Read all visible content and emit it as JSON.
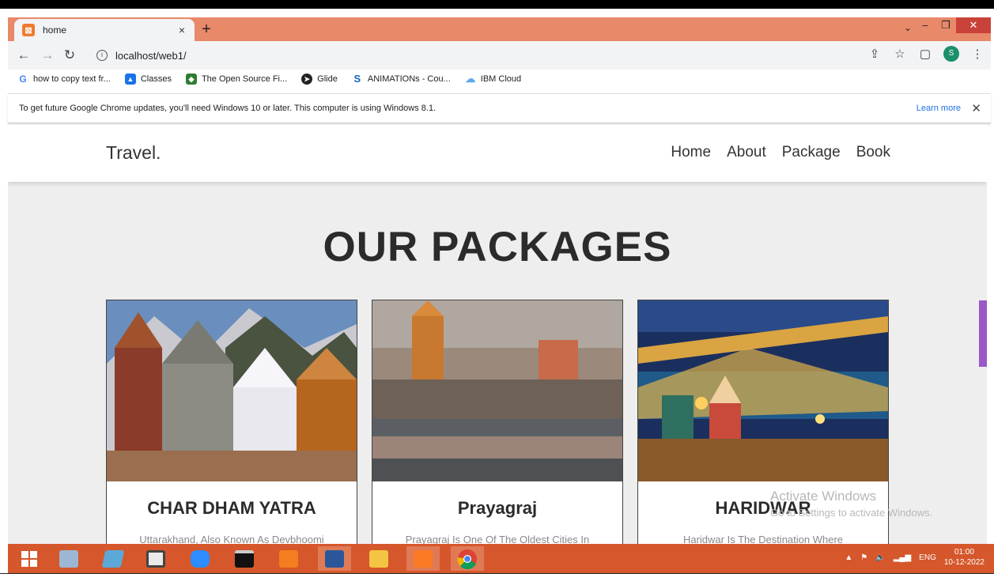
{
  "browser": {
    "tab_title": "home",
    "tab_close": "×",
    "new_tab": "+",
    "url": "localhost/web1/",
    "profile_initial": "S",
    "bookmarks": [
      {
        "label": "how to copy text fr...",
        "icon": "google-icon",
        "color": "#4285f4"
      },
      {
        "label": "Classes",
        "icon": "classes-icon",
        "color": "#1a73e8"
      },
      {
        "label": "The Open Source Fi...",
        "icon": "open-source-icon",
        "color": "#2e7d32"
      },
      {
        "label": "Glide",
        "icon": "glide-icon",
        "color": "#222222"
      },
      {
        "label": "ANIMATIONs - Cou...",
        "icon": "skillshare-icon",
        "color": "#1565c0"
      },
      {
        "label": "IBM Cloud",
        "icon": "cloud-icon",
        "color": "#5fa8e8"
      }
    ],
    "infobar_text": "To get future Google Chrome updates, you'll need Windows 10 or later. This computer is using Windows 8.1.",
    "learn_more": "Learn more"
  },
  "site": {
    "logo": "Travel.",
    "nav": [
      "Home",
      "About",
      "Package",
      "Book"
    ],
    "heading": "OUR PACKAGES",
    "cards": [
      {
        "title": "CHAR DHAM YATRA",
        "desc": "Uttarakhand, Also Known As Devbhoomi"
      },
      {
        "title": "Prayagraj",
        "desc": "Prayagraj Is One Of The Oldest Cities In"
      },
      {
        "title": "HARIDWAR",
        "desc": "Haridwar Is The Destination Where"
      }
    ]
  },
  "watermark": {
    "title": "Activate Windows",
    "sub": "Go to Settings to activate Windows."
  },
  "taskbar": {
    "lang": "ENG",
    "time": "01:00",
    "date": "10-12-2022"
  },
  "colors": {
    "tabstrip": "#e8896a",
    "taskbar": "#d5572b",
    "page_bg": "#eeeeee"
  }
}
